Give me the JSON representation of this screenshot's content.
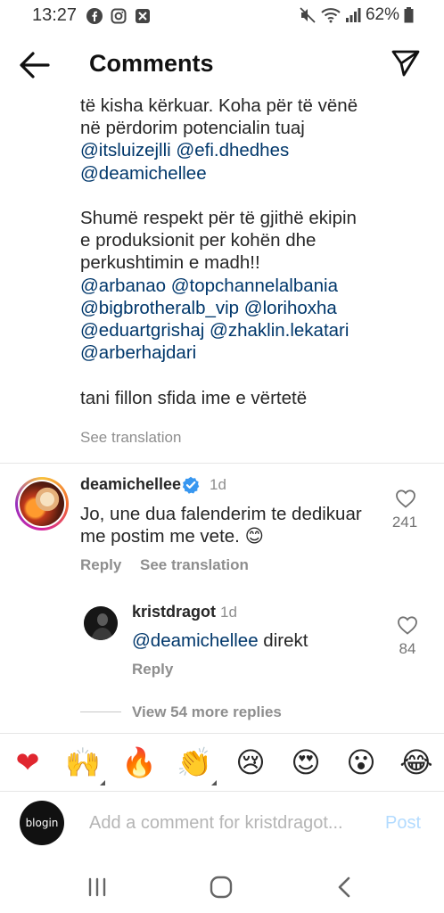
{
  "status_bar": {
    "time": "13:27",
    "battery": "62%",
    "icons": [
      "facebook-icon",
      "instagram-icon",
      "x-notification-icon",
      "mute-icon",
      "wifi-icon",
      "signal-icon",
      "battery-icon"
    ]
  },
  "header": {
    "title": "Comments",
    "back_icon": "back-arrow-icon",
    "send_icon": "send-icon"
  },
  "caption": {
    "line1": "të kisha kërkuar. Koha për të vënë",
    "line2": "në përdorim potencialin tuaj",
    "mentions1_a": "@itsluizejlli",
    "mentions1_b": "@efi.dhedhes",
    "mentions1_c": "@deamichellee",
    "para2_line1": "Shumë respekt për të gjithë ekipin",
    "para2_line2": "e produksionit per kohën dhe",
    "para2_line3": "perkushtimin e madh!!",
    "m2_a": "@arbanao",
    "m2_b": "@topchannelalbania",
    "m2_c": "@bigbrotheralb_vip",
    "m2_d": "@lorihoxha",
    "m2_e": "@eduartgrishaj",
    "m2_f": "@zhaklin.lekatari",
    "m2_g": "@arberhajdari",
    "para3": "tani fillon sfida ime e vërtetë",
    "see_translation": "See translation"
  },
  "comment1": {
    "username": "deamichellee",
    "verified_icon": "verified-badge-icon",
    "time": "1d",
    "text_line1": "Jo, une dua falenderim te dedikuar",
    "text_line2": "me postim me vete.",
    "emoji": "😊",
    "likes": "241",
    "reply": "Reply",
    "see_translation": "See translation"
  },
  "reply1": {
    "username": "kristdragot",
    "time": "1d",
    "mention": "@deamichellee",
    "text": " direkt",
    "likes": "84",
    "reply": "Reply"
  },
  "view_more": "View 54 more replies",
  "emoji_bar": [
    "❤",
    "🙌",
    "🔥",
    "👏",
    "😢",
    "😍",
    "😮",
    "😂"
  ],
  "composer": {
    "avatar_text": "blogin",
    "placeholder": "Add a comment for kristdragot...",
    "post": "Post"
  },
  "colors": {
    "mention": "#00376b",
    "secondary": "#8e8e8e",
    "post_disabled": "#b3dbff",
    "verified": "#3897f0"
  }
}
